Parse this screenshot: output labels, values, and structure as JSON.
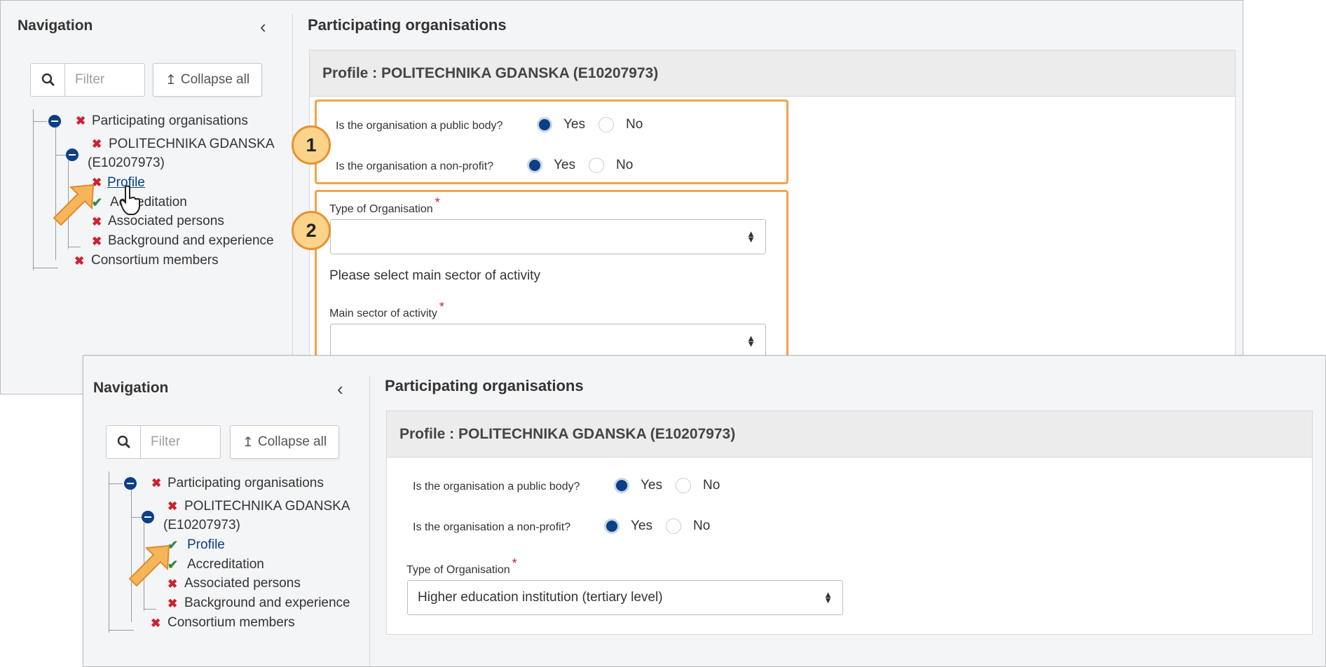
{
  "shot1": {
    "nav": {
      "title": "Navigation",
      "collapse_icon": "chevron-left-icon",
      "filter_placeholder": "Filter",
      "collapse_all": "Collapse all",
      "tree": {
        "root": "Participating organisations",
        "org_line1": "POLITECHNIKA GDANSKA",
        "org_line2": "(E10207973)",
        "profile": "Profile",
        "accreditation": "Accreditation",
        "associated": "Associated persons",
        "background": "Background and experience",
        "consortium": "Consortium members"
      }
    },
    "main": {
      "title": "Participating organisations",
      "panel_title": "Profile : POLITECHNIKA GDANSKA (E10207973)",
      "q_public": "Is the organisation a public body?",
      "q_nonprofit": "Is the organisation a non-profit?",
      "yes": "Yes",
      "no": "No",
      "type_label": "Type of Organisation",
      "type_value": "",
      "sector_hint": "Please select main sector of activity",
      "sector_label": "Main sector of activity",
      "sector_value": "",
      "required_mark": "*"
    },
    "callouts": {
      "one": "1",
      "two": "2"
    }
  },
  "shot2": {
    "nav": {
      "title": "Navigation",
      "filter_placeholder": "Filter",
      "collapse_all": "Collapse all",
      "tree": {
        "root": "Participating organisations",
        "org_line1": "POLITECHNIKA GDANSKA",
        "org_line2": "(E10207973)",
        "profile": "Profile",
        "accreditation": "Accreditation",
        "associated": "Associated persons",
        "background": "Background and experience",
        "consortium": "Consortium members"
      }
    },
    "main": {
      "title": "Participating organisations",
      "panel_title": "Profile : POLITECHNIKA GDANSKA (E10207973)",
      "q_public": "Is the organisation a public body?",
      "q_nonprofit": "Is the organisation a non-profit?",
      "yes": "Yes",
      "no": "No",
      "type_label": "Type of Organisation",
      "type_value": "Higher education institution (tertiary level)",
      "required_mark": "*"
    }
  },
  "colors": {
    "accent_blue": "#0b3f86",
    "error_red": "#d0202d",
    "ok_green": "#2f8a3c",
    "callout_orange": "#f0a44a"
  }
}
